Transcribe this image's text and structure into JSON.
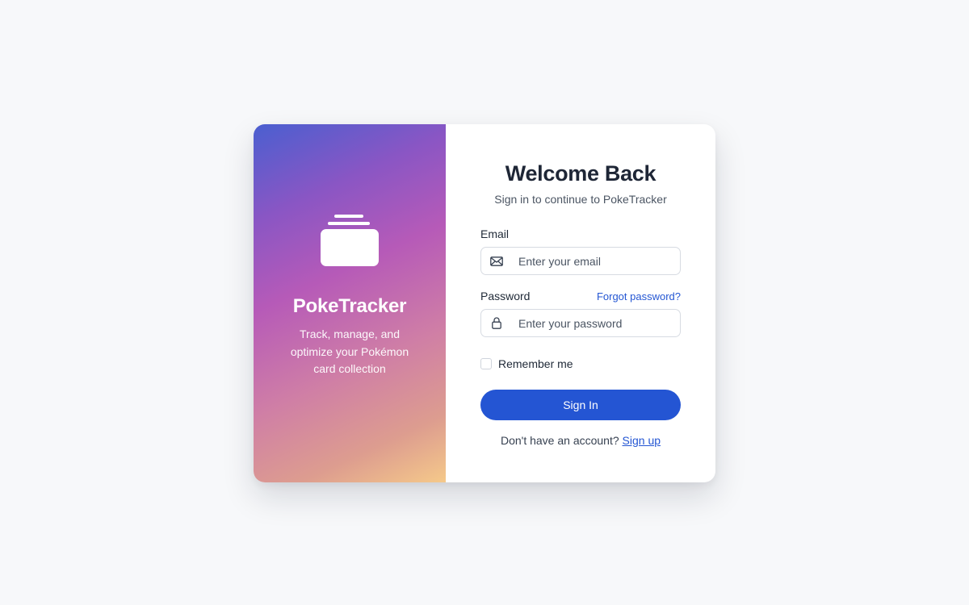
{
  "brand": {
    "name": "PokeTracker",
    "tagline": "Track, manage, and optimize your Pokémon card collection",
    "logo_icon": "card-stack-icon"
  },
  "form": {
    "title": "Welcome Back",
    "subtitle": "Sign in to continue to PokeTracker",
    "email": {
      "label": "Email",
      "placeholder": "Enter your email",
      "value": "",
      "icon": "mail-icon"
    },
    "password": {
      "label": "Password",
      "placeholder": "Enter your password",
      "value": "",
      "icon": "lock-icon",
      "forgot_label": "Forgot password?"
    },
    "remember_label": "Remember me",
    "remember_checked": false,
    "submit_label": "Sign In",
    "signup_prompt": "Don't have an account?",
    "signup_label": "Sign up"
  },
  "colors": {
    "accent": "#2455d3",
    "gradient": [
      "#4a5fd0",
      "#b65ab8",
      "#dd9d8f",
      "#f5c98a"
    ],
    "page_background": "#f7f8fa"
  }
}
